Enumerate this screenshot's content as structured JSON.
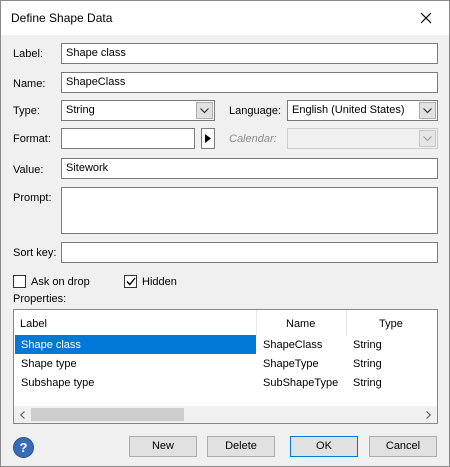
{
  "window": {
    "title": "Define Shape Data"
  },
  "form": {
    "label_label": "Label:",
    "label_value": "Shape class",
    "name_label": "Name:",
    "name_value": "ShapeClass",
    "type_label": "Type:",
    "type_value": "String",
    "language_label": "Language:",
    "language_value": "English (United States)",
    "format_label": "Format:",
    "format_value": "",
    "calendar_label": "Calendar:",
    "calendar_value": "",
    "value_label": "Value:",
    "value_value": "Sitework",
    "prompt_label": "Prompt:",
    "prompt_value": "",
    "sortkey_label": "Sort key:",
    "sortkey_value": "",
    "ask_on_drop_label": "Ask on drop",
    "ask_on_drop_checked": false,
    "hidden_label": "Hidden",
    "hidden_checked": true,
    "properties_label": "Properties:"
  },
  "properties": {
    "columns": [
      "Label",
      "Name",
      "Type"
    ],
    "rows": [
      {
        "label": "Shape class",
        "name": "ShapeClass",
        "type": "String",
        "selected": true
      },
      {
        "label": "Shape type",
        "name": "ShapeType",
        "type": "String",
        "selected": false
      },
      {
        "label": "Subshape type",
        "name": "SubShapeType",
        "type": "String",
        "selected": false
      }
    ]
  },
  "buttons": {
    "new": "New",
    "delete": "Delete",
    "ok": "OK",
    "cancel": "Cancel",
    "help": "?"
  },
  "colors": {
    "selection": "#0078d7",
    "help_icon": "#3a6bb5",
    "focus_border": "#0078d7"
  }
}
